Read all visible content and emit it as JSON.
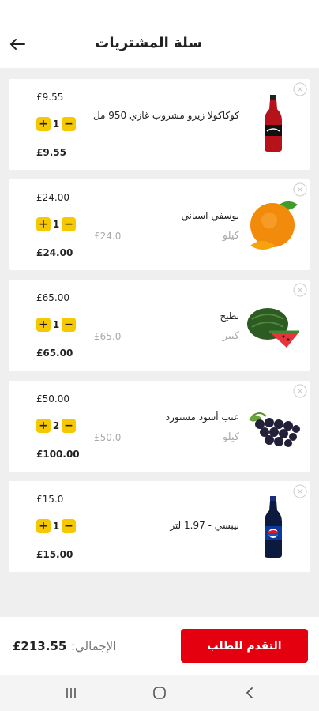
{
  "header": {
    "title": "سلة المشتريات",
    "back_icon": "arrow-left-icon"
  },
  "items": [
    {
      "name": "كوكاكولا زيرو مشروب غازي 950 مل",
      "unit": "",
      "list_price": "",
      "unit_price": "£9.55",
      "quantity": "1",
      "total": "£9.55",
      "image": "coke-bottle"
    },
    {
      "name": "يوسفي اسباني",
      "unit": "كيلو",
      "list_price": "£24.0",
      "unit_price": "£24.00",
      "quantity": "1",
      "total": "£24.00",
      "image": "orange"
    },
    {
      "name": "بطيخ",
      "unit": "كبير",
      "list_price": "£65.0",
      "unit_price": "£65.00",
      "quantity": "1",
      "total": "£65.00",
      "image": "watermelon"
    },
    {
      "name": "عنب أسود مستورد",
      "unit": "كيلو",
      "list_price": "£50.0",
      "unit_price": "£50.00",
      "quantity": "2",
      "total": "£100.00",
      "image": "grapes"
    },
    {
      "name": "بيبسي - 1.97 لتر",
      "unit": "",
      "list_price": "",
      "unit_price": "£15.0",
      "quantity": "1",
      "total": "£15.00",
      "image": "pepsi-bottle"
    }
  ],
  "footer": {
    "checkout_label": "التقدم للطلب",
    "total_label": "الإجمالي:",
    "grand_total": "£213.55"
  },
  "colors": {
    "accent": "#e5000f",
    "qty_button": "#f6c800"
  }
}
